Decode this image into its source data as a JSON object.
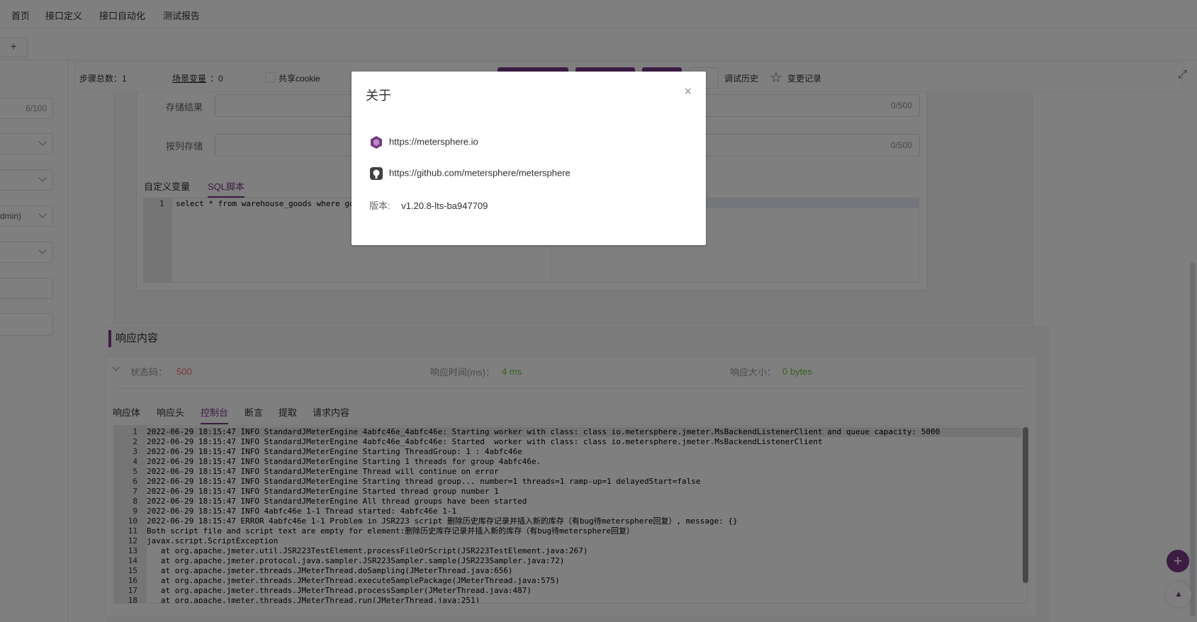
{
  "nav": {
    "tabs": [
      "首页",
      "接口定义",
      "接口自动化",
      "测试报告"
    ],
    "active_index": 2,
    "add_label": "+"
  },
  "left": {
    "count": "6/100",
    "select_text": "dmin)"
  },
  "scenario_header": {
    "steps_label": "步骤总数：1",
    "vars_label": "场景变量",
    "vars_value": "：0",
    "cookie_label": "共享cookie",
    "debug_history": "调试历史",
    "change_log": "变更记录"
  },
  "sql_form": {
    "store_result_label": "存储结果",
    "store_result_count": "0/500",
    "store_by_column_label": "按列存储",
    "store_by_column_count": "0/500",
    "tab_vars": "自定义变量",
    "tab_sql": "SQL脚本",
    "sql_line_no": "1",
    "sql_text": "select * from warehouse_goods where go"
  },
  "response": {
    "title": "响应内容",
    "status_label": "状态码：",
    "status_value": "500",
    "time_label": "响应时间(ms)：",
    "time_value": "4 ms",
    "size_label": "响应大小：",
    "size_value": "0 bytes",
    "tabs": [
      "响应体",
      "响应头",
      "控制台",
      "断言",
      "提取",
      "请求内容"
    ],
    "active_tab": 2,
    "console_lines": [
      "2022-06-29 18:15:47 INFO StandardJMeterEngine 4abfc46e_4abfc46e: Starting worker with class: class io.metersphere.jmeter.MsBackendListenerClient and queue capacity: 5000",
      "2022-06-29 18:15:47 INFO StandardJMeterEngine 4abfc46e_4abfc46e: Started  worker with class: class io.metersphere.jmeter.MsBackendListenerClient",
      "2022-06-29 18:15:47 INFO StandardJMeterEngine Starting ThreadGroup: 1 : 4abfc46e",
      "2022-06-29 18:15:47 INFO StandardJMeterEngine Starting 1 threads for group 4abfc46e.",
      "2022-06-29 18:15:47 INFO StandardJMeterEngine Thread will continue on error",
      "2022-06-29 18:15:47 INFO StandardJMeterEngine Starting thread group... number=1 threads=1 ramp-up=1 delayedStart=false",
      "2022-06-29 18:15:47 INFO StandardJMeterEngine Started thread group number 1",
      "2022-06-29 18:15:47 INFO StandardJMeterEngine All thread groups have been started",
      "2022-06-29 18:15:47 INFO 4abfc46e 1-1 Thread started: 4abfc46e 1-1",
      "2022-06-29 18:15:47 ERROR 4abfc46e 1-1 Problem in JSR223 script 删除历史库存记录并插入新的库存（有bug待metersphere回复）, message: {}",
      "Both script file and script text are empty for element:删除历史库存记录并插入新的库存（有bug待metersphere回复）",
      "javax.script.ScriptException",
      "   at org.apache.jmeter.util.JSR223TestElement.processFileOrScript(JSR223TestElement.java:267)",
      "   at org.apache.jmeter.protocol.java.sampler.JSR223Sampler.sample(JSR223Sampler.java:72)",
      "   at org.apache.jmeter.threads.JMeterThread.doSampling(JMeterThread.java:656)",
      "   at org.apache.jmeter.threads.JMeterThread.executeSamplePackage(JMeterThread.java:575)",
      "   at org.apache.jmeter.threads.JMeterThread.processSampler(JMeterThread.java:487)",
      "   at org.apache.jmeter.threads.JMeterThread.run(JMeterThread.java:251)"
    ]
  },
  "dialog": {
    "title": "关于",
    "close": "×",
    "website": "https://metersphere.io",
    "github": "https://github.com/metersphere/metersphere",
    "version_label": "版本:",
    "version_value": "v1.20.8-lts-ba947709"
  },
  "fab": {
    "add": "+",
    "top": "▲"
  },
  "colors": {
    "accent": "#783887",
    "error": "#f56c6c",
    "success": "#67c23a"
  }
}
